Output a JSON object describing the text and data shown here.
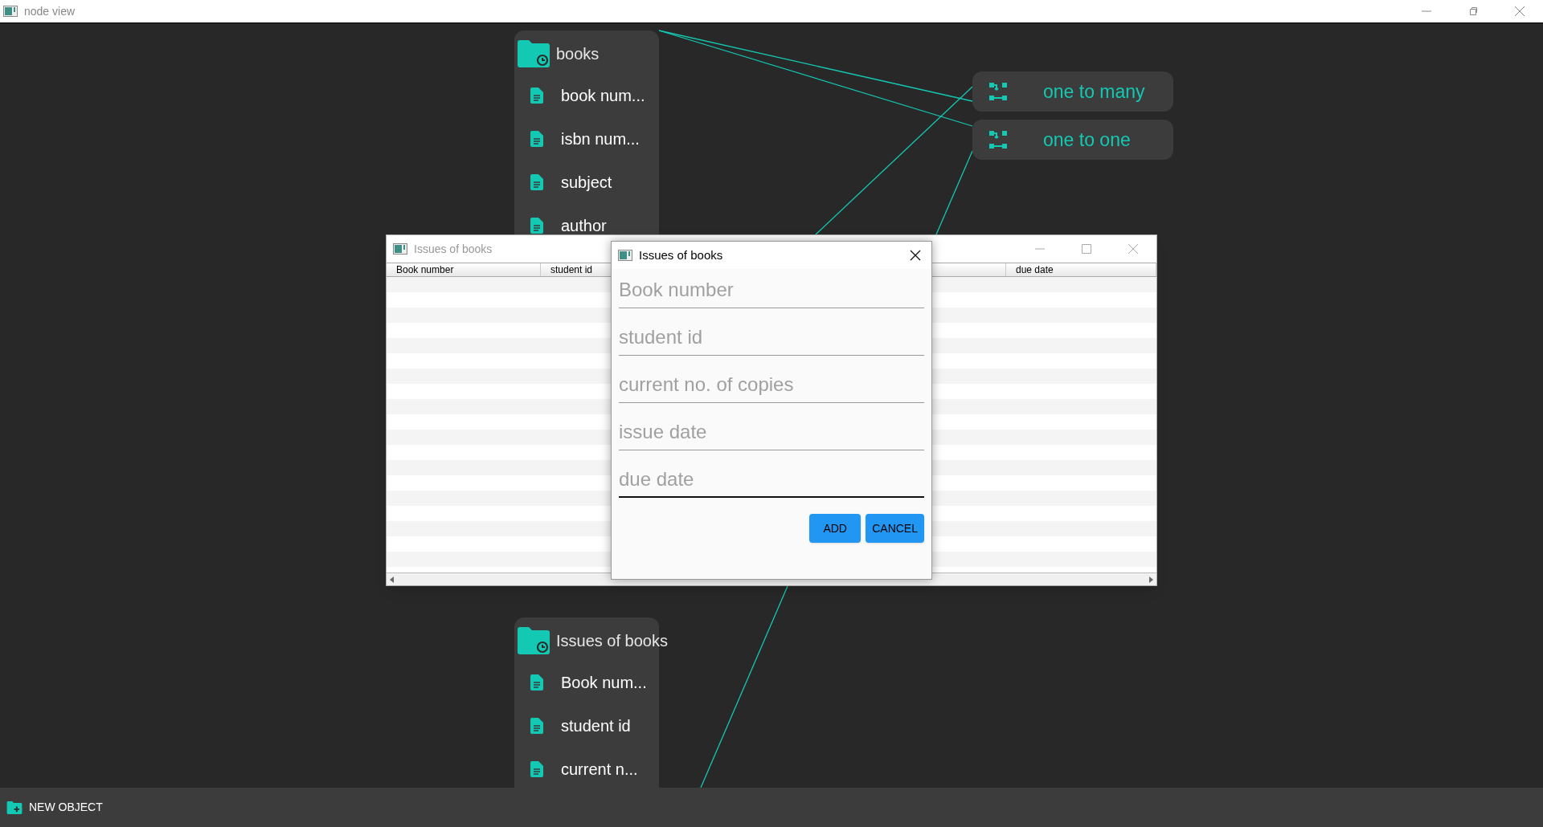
{
  "window": {
    "title": "node view"
  },
  "nodes": [
    {
      "title": "books",
      "fields": [
        "book num...",
        "isbn num...",
        "subject",
        "author"
      ]
    },
    {
      "title": "Issues of books",
      "fields": [
        "Book num...",
        "student id",
        "current n..."
      ]
    }
  ],
  "relations": [
    {
      "label": "one to many"
    },
    {
      "label": "one to one"
    }
  ],
  "table_window": {
    "title": "Issues of books",
    "columns": [
      "Book number",
      "student id",
      "due date"
    ]
  },
  "dialog": {
    "title": "Issues of books",
    "fields": [
      {
        "placeholder": "Book number",
        "focused": false
      },
      {
        "placeholder": "student id",
        "focused": false
      },
      {
        "placeholder": "current no. of copies",
        "focused": false
      },
      {
        "placeholder": "issue date",
        "focused": false
      },
      {
        "placeholder": "due date",
        "focused": true
      }
    ],
    "buttons": [
      "ADD",
      "CANCEL"
    ]
  },
  "bottom_bar": {
    "button": "NEW OBJECT"
  }
}
